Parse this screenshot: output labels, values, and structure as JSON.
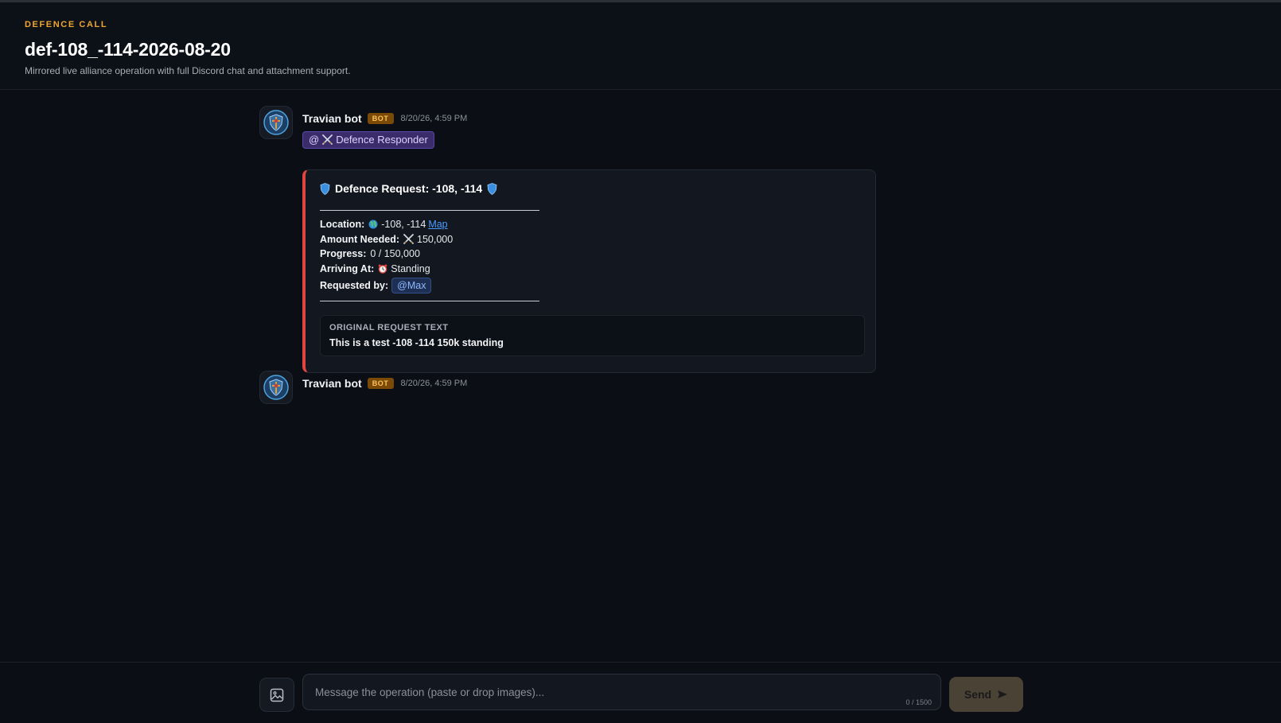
{
  "header": {
    "kicker": "DEFENCE CALL",
    "title": "def-108_-114-2026-08-20",
    "subtitle": "Mirrored live alliance operation with full Discord chat and attachment support."
  },
  "messages": [
    {
      "author": "Travian bot",
      "badge": "BOT",
      "timestamp": "8/20/26, 4:59 PM",
      "role_mention": "Defence Responder",
      "embed": {
        "accent_color": "#e0463e",
        "title": "Defence Request: -108, -114",
        "fields": {
          "location_label": "Location:",
          "location_value": "-108, -114",
          "map_link": "Map",
          "amount_label": "Amount Needed:",
          "amount_value": "150,000",
          "progress_label": "Progress:",
          "progress_value": "0 / 150,000",
          "arriving_label": "Arriving At:",
          "arriving_value": "Standing",
          "requested_label": "Requested by:",
          "requested_value": "@Max"
        },
        "quote_label": "ORIGINAL REQUEST TEXT",
        "quote_text": "This is a test -108 -114 150k standing"
      }
    },
    {
      "author": "Travian bot",
      "badge": "BOT",
      "timestamp": "8/20/26, 4:59 PM"
    }
  ],
  "composer": {
    "placeholder": "Message the operation (paste or drop images)...",
    "counter": "0 / 1500",
    "send_label": "Send"
  },
  "colors": {
    "accent": "#f0a531",
    "background": "#0b0e14",
    "embed_border": "#e0463e",
    "link": "#4b9cff"
  }
}
